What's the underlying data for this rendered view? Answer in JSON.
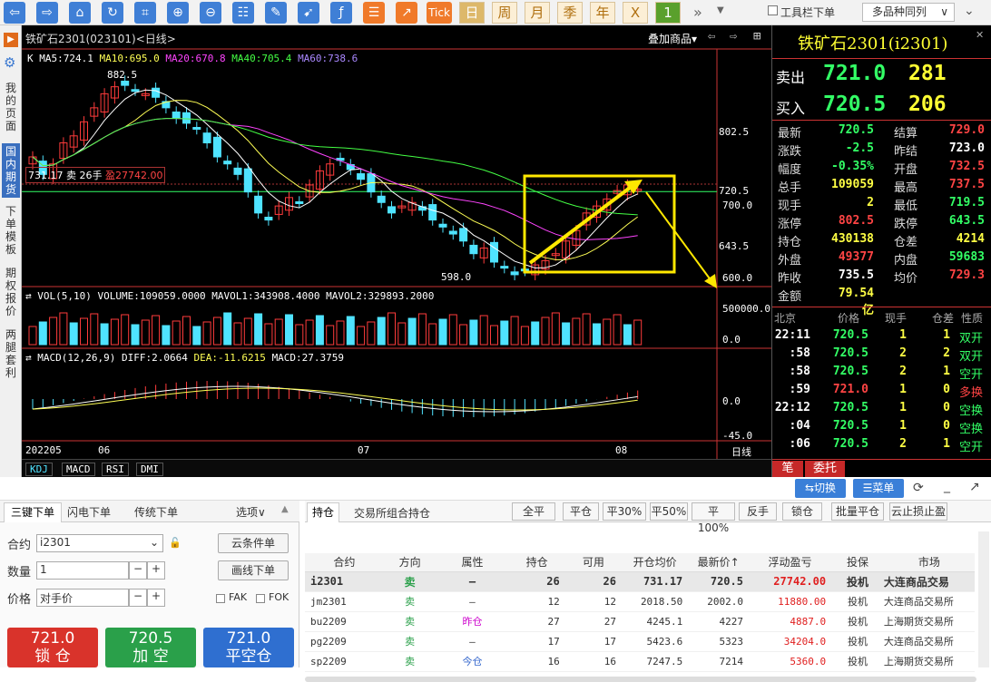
{
  "toolbar": {
    "period_buttons": [
      "日",
      "周",
      "月",
      "季",
      "年"
    ],
    "tick_label": "Tick",
    "x_label": "X",
    "one_label": "1",
    "more_label": "»",
    "toolbar_order_label": "工具栏下单",
    "multi_label": "多品种同列"
  },
  "leftnav": {
    "items": [
      "我的页面",
      "国内期货",
      "下单模板",
      "期权报价",
      "两腿套利"
    ],
    "active": "国内期货"
  },
  "chart": {
    "title": "铁矿石2301(023101)<日线>",
    "overlay_label": "叠加商品",
    "ma_line": {
      "k": "K",
      "ma5": "MA5:724.1",
      "ma10": "MA10:695.0",
      "ma20": "MA20:670.8",
      "ma40": "MA40:705.4",
      "ma60": "MA60:738.6"
    },
    "price_labels": [
      "802.5",
      "720.5",
      "700.0",
      "643.5",
      "600.0"
    ],
    "high_label": "882.5",
    "low_label": "598.0",
    "position_line": "731.17  卖  26手",
    "profit_label": "盈27742.00",
    "vol_line": "VOL(5,10) VOLUME:109059.0000 MAVOL1:343908.4000 MAVOL2:329893.2000",
    "vol_labels": [
      "500000.0",
      "0.0"
    ],
    "macd_line": {
      "name": "MACD(12,26,9)",
      "diff": "DIFF:2.0664",
      "dea": "DEA:-11.6215",
      "macd": "MACD:27.3759"
    },
    "macd_labels": [
      "0.0",
      "-45.0"
    ],
    "date_labels": [
      "202205",
      "06",
      "07",
      "08"
    ],
    "period_label": "日线",
    "indicator_tabs": [
      "KDJ",
      "MACD",
      "RSI",
      "DMI"
    ],
    "colors": {
      "up": "#ff3b3b",
      "down": "#4fe3ff",
      "ma5": "#ffffff",
      "ma10": "#ffff55",
      "ma20": "#ff44ff",
      "ma40": "#44ff44",
      "ma60": "#aa66ff",
      "annotation": "#ffe800"
    }
  },
  "chart_data": {
    "type": "candlestick",
    "title": "铁矿石2301(023101)<日线>",
    "ylim": [
      598,
      882.5
    ],
    "x": [
      "202205",
      "06",
      "07",
      "08"
    ],
    "last": 720.5,
    "ma": {
      "MA5": 724.1,
      "MA10": 695.0,
      "MA20": 670.8,
      "MA40": 705.4,
      "MA60": 738.6
    },
    "volume": {
      "VOLUME": 109059,
      "MAVOL1": 343908.4,
      "MAVOL2": 329893.2
    },
    "macd": {
      "DIFF": 2.0664,
      "DEA": -11.6215,
      "MACD": 27.3759
    }
  },
  "quote": {
    "title": "铁矿石2301(i2301)",
    "sell": {
      "label": "卖出",
      "price": "721.0",
      "vol": "281"
    },
    "buy": {
      "label": "买入",
      "price": "720.5",
      "vol": "206"
    },
    "rows": [
      {
        "l1": "最新",
        "v1": "720.5",
        "c1": "#33ff66",
        "l2": "结算",
        "v2": "729.0",
        "c2": "#ff4444"
      },
      {
        "l1": "涨跌",
        "v1": "-2.5",
        "c1": "#33ff66",
        "l2": "昨结",
        "v2": "723.0",
        "c2": "#ffffff"
      },
      {
        "l1": "幅度",
        "v1": "-0.35%",
        "c1": "#33ff66",
        "l2": "开盘",
        "v2": "732.5",
        "c2": "#ff4444"
      },
      {
        "l1": "总手",
        "v1": "109059",
        "c1": "#ffff44",
        "l2": "最高",
        "v2": "737.5",
        "c2": "#ff4444"
      },
      {
        "l1": "现手",
        "v1": "2",
        "c1": "#ffff44",
        "l2": "最低",
        "v2": "719.5",
        "c2": "#33ff66"
      },
      {
        "l1": "涨停",
        "v1": "802.5",
        "c1": "#ff4444",
        "l2": "跌停",
        "v2": "643.5",
        "c2": "#33ff66"
      },
      {
        "l1": "持仓",
        "v1": "430138",
        "c1": "#ffff44",
        "l2": "仓差",
        "v2": "4214",
        "c2": "#ffff44"
      },
      {
        "l1": "外盘",
        "v1": "49377",
        "c1": "#ff4444",
        "l2": "内盘",
        "v2": "59683",
        "c2": "#33ff66"
      },
      {
        "l1": "昨收",
        "v1": "735.5",
        "c1": "#ffffff",
        "l2": "均价",
        "v2": "729.3",
        "c2": "#ff4444"
      },
      {
        "l1": "金额",
        "v1": "79.54亿",
        "c1": "#ffff44",
        "l2": "",
        "v2": "",
        "c2": "#ffffff"
      }
    ],
    "tick_header": [
      "北京",
      "价格",
      "现手",
      "仓差",
      "性质"
    ],
    "ticks": [
      {
        "t": "22:11",
        "p": "720.5",
        "v": "1",
        "d": "1",
        "n": "双开",
        "nc": "#33ff66"
      },
      {
        "t": ":58",
        "p": "720.5",
        "v": "2",
        "d": "2",
        "n": "双开",
        "nc": "#33ff66"
      },
      {
        "t": ":58",
        "p": "720.5",
        "v": "2",
        "d": "1",
        "n": "空开",
        "nc": "#33ff66"
      },
      {
        "t": ":59",
        "p": "721.0",
        "v": "1",
        "d": "0",
        "n": "多换",
        "nc": "#ff4444"
      },
      {
        "t": "22:12",
        "p": "720.5",
        "v": "1",
        "d": "0",
        "n": "空换",
        "nc": "#33ff66"
      },
      {
        "t": ":04",
        "p": "720.5",
        "v": "1",
        "d": "0",
        "n": "空换",
        "nc": "#33ff66"
      },
      {
        "t": ":06",
        "p": "720.5",
        "v": "2",
        "d": "1",
        "n": "空开",
        "nc": "#33ff66"
      }
    ],
    "bottom_tabs": [
      "笔",
      "委托"
    ]
  },
  "order": {
    "top_right": {
      "switch": "⇆切换",
      "menu": "☰菜单"
    },
    "tabs": [
      "三键下单",
      "闪电下单",
      "传统下单"
    ],
    "options": "选项∨",
    "contract_label": "合约",
    "contract_value": "i2301",
    "qty_label": "数量",
    "qty_value": "1",
    "price_label": "价格",
    "price_value": "对手价",
    "cloud_btn": "云条件单",
    "line_btn": "画线下单",
    "fak": "FAK",
    "fok": "FOK",
    "big_buttons": [
      {
        "price": "721.0",
        "label": "锁 仓",
        "color": "#d9332b"
      },
      {
        "price": "720.5",
        "label": "加 空",
        "color": "#2aa04a"
      },
      {
        "price": "721.0",
        "label": "平空仓",
        "color": "#2f6fd0"
      }
    ]
  },
  "positions": {
    "tabs": [
      "持仓",
      "交易所组合持仓"
    ],
    "actions": [
      "全平",
      "平仓",
      "平30%",
      "平50%",
      "平100%",
      "反手",
      "锁仓",
      "批量平仓",
      "云止损止盈"
    ],
    "headers": [
      "合约",
      "方向",
      "属性",
      "持仓",
      "可用",
      "开仓均价",
      "最新价↑",
      "浮动盈亏",
      "投保",
      "市场"
    ],
    "rows": [
      {
        "c": "i2301",
        "dir": "卖",
        "attr": "—",
        "pos": "26",
        "avail": "26",
        "open": "731.17",
        "last": "720.5",
        "pnl": "27742.00",
        "hedge": "投机",
        "mkt": "大连商品交易",
        "attr_color": "#333"
      },
      {
        "c": "jm2301",
        "dir": "卖",
        "attr": "—",
        "pos": "12",
        "avail": "12",
        "open": "2018.50",
        "last": "2002.0",
        "pnl": "11880.00",
        "hedge": "投机",
        "mkt": "大连商品交易所",
        "attr_color": "#333"
      },
      {
        "c": "bu2209",
        "dir": "卖",
        "attr": "昨仓",
        "pos": "27",
        "avail": "27",
        "open": "4245.1",
        "last": "4227",
        "pnl": "4887.0",
        "hedge": "投机",
        "mkt": "上海期货交易所",
        "attr_color": "#cc00cc"
      },
      {
        "c": "pg2209",
        "dir": "卖",
        "attr": "—",
        "pos": "17",
        "avail": "17",
        "open": "5423.6",
        "last": "5323",
        "pnl": "34204.0",
        "hedge": "投机",
        "mkt": "大连商品交易所",
        "attr_color": "#333"
      },
      {
        "c": "sp2209",
        "dir": "卖",
        "attr": "今仓",
        "pos": "16",
        "avail": "16",
        "open": "7247.5",
        "last": "7214",
        "pnl": "5360.0",
        "hedge": "投机",
        "mkt": "上海期货交易所",
        "attr_color": "#3366cc"
      }
    ]
  }
}
